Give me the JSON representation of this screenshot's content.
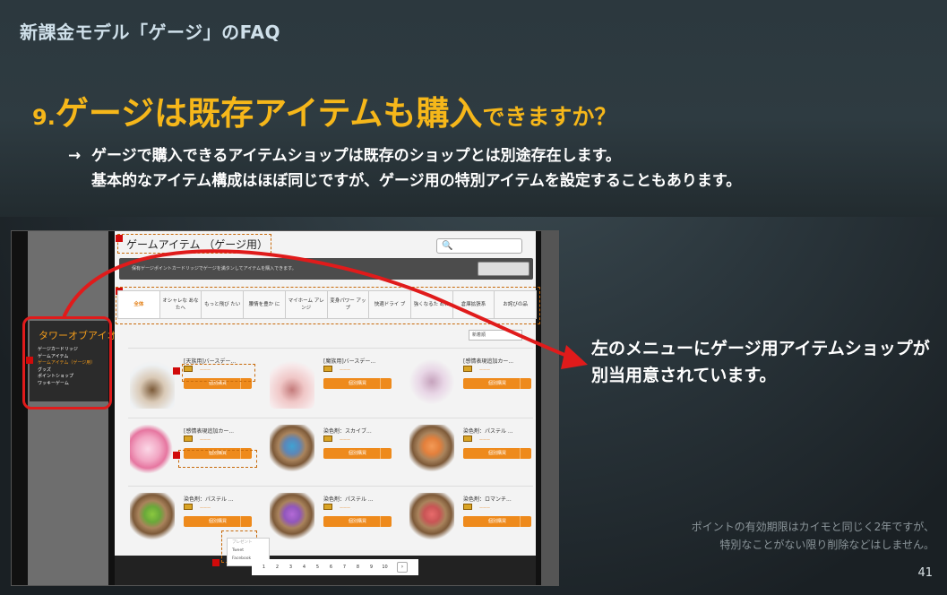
{
  "slide": {
    "title": "新課金モデル「ゲージ」のFAQ",
    "question_num": "9.",
    "question_main": "ゲージは既存アイテムも購入",
    "question_tail": "できますか？",
    "answer_arrow": "→",
    "answer_line1": "ゲージで購入できるアイテムショップは既存のショップとは別途存在します。",
    "answer_line2": "基本的なアイテム構成はほぼ同じですが、ゲージ用の特別アイテムを設定することもあります。",
    "callout_line1": "左のメニューにゲージ用アイテムショップが",
    "callout_line2": "別当用意されています。",
    "footnote_line1": "ポイントの有効期限はカイモと同じく2年ですが、",
    "footnote_line2": "特別なことがない限り削除などはしません。",
    "page_number": "41",
    "accent_color": "#f6b71a",
    "highlight_color": "#e01b1b"
  },
  "shop": {
    "title": "ゲームアイテム （ゲージ用）",
    "search_placeholder": "🔍",
    "sidebar_title": "タワーオブアイオン",
    "sidebar_items": [
      "ゲージカードリッジ",
      "ゲームアイテム",
      "ゲームアイテム（ゲージ用）",
      "グッズ",
      "ポイントショップ",
      "ワッキーゲーム"
    ],
    "notice_text": "保有ゲージポイントカードリッジでゲージを満タンしてアイテムを購入できます。",
    "tabs": [
      "全体",
      "オシャレな あなたへ",
      "もっと飛び たい",
      "腰情を豊か に",
      "マイホーム アレンジ",
      "変身パワー アップ",
      "快適ドライ ブ",
      "強くなるた めに",
      "倉庫拡張系",
      "お詫びの品"
    ],
    "sort_label": "新着順",
    "buy_label": "個別購買",
    "items": [
      {
        "name": "[天族用]バースデー...",
        "thumb": "cake1"
      },
      {
        "name": "[魔族用]バースデー...",
        "thumb": "cake2"
      },
      {
        "name": "[感情表現追加カー...",
        "thumb": "doll"
      },
      {
        "name": "[感情表現追加カー...",
        "thumb": "ball"
      },
      {
        "name": "染色剤：スカイブ...",
        "thumb": "bucket-blue"
      },
      {
        "name": "染色剤：パステル ...",
        "thumb": "bucket-orange"
      },
      {
        "name": "染色剤：パステル ...",
        "thumb": "bucket-green"
      },
      {
        "name": "染色剤：パステル ...",
        "thumb": "bucket-purple"
      },
      {
        "name": "染色剤：ロマンチ...",
        "thumb": "bucket-red"
      }
    ],
    "popup": [
      "プレゼント",
      "Tweet",
      "Facebook"
    ],
    "pager": [
      "1",
      "2",
      "3",
      "4",
      "5",
      "6",
      "7",
      "8",
      "9",
      "10"
    ],
    "pager_next": "›"
  }
}
